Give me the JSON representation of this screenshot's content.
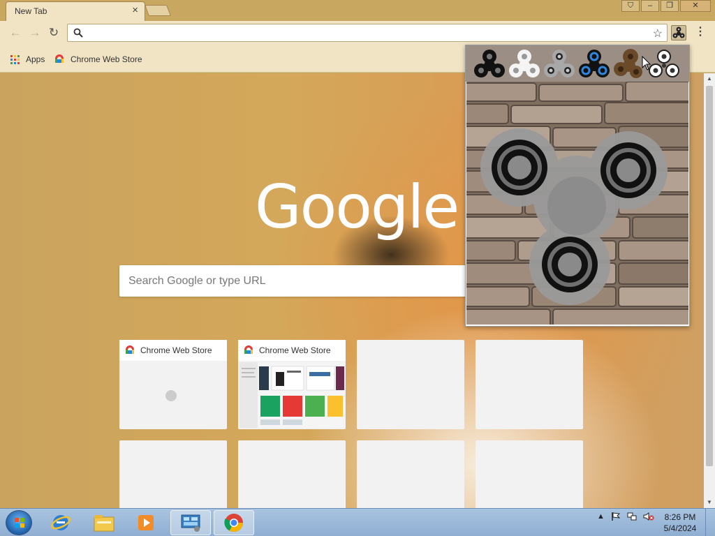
{
  "browser": {
    "tab_title": "New Tab",
    "tab_close": "×",
    "window_buttons": [
      "⛉",
      "–",
      "❐",
      "✕"
    ],
    "nav": {
      "back": "←",
      "forward": "→",
      "reload": "↻"
    },
    "address": "",
    "bookmark_star": "☆",
    "menu": "⋮"
  },
  "bookmarks": {
    "items": [
      {
        "label": "Apps",
        "icon": "apps-grid-icon"
      },
      {
        "label": "Chrome Web Store",
        "icon": "chrome-web-store-icon"
      }
    ]
  },
  "ntp": {
    "logo": "Google",
    "search_placeholder": "Search Google or type URL",
    "tiles": [
      {
        "title": "Chrome Web Store",
        "state": "loading"
      },
      {
        "title": "Chrome Web Store",
        "state": "thumbnail"
      },
      {
        "title": "",
        "state": "empty"
      },
      {
        "title": "",
        "state": "empty"
      },
      {
        "title": "",
        "state": "empty"
      },
      {
        "title": "",
        "state": "empty"
      },
      {
        "title": "",
        "state": "empty"
      },
      {
        "title": "",
        "state": "empty"
      }
    ]
  },
  "extension_popup": {
    "spinner_options": [
      "black",
      "white",
      "grey",
      "blue-black",
      "bronze",
      "outline"
    ],
    "selected": "grey",
    "background": "stone-wall"
  },
  "taskbar": {
    "apps": [
      "internet-explorer",
      "windows-explorer",
      "media-player",
      "control-panel",
      "chrome"
    ],
    "active": "chrome",
    "time": "8:26 PM",
    "date": "5/4/2024"
  },
  "colors": {
    "accent_frame": "#c8a760",
    "toolbar": "#f1e4c4",
    "taskbar": "#8faed2"
  }
}
